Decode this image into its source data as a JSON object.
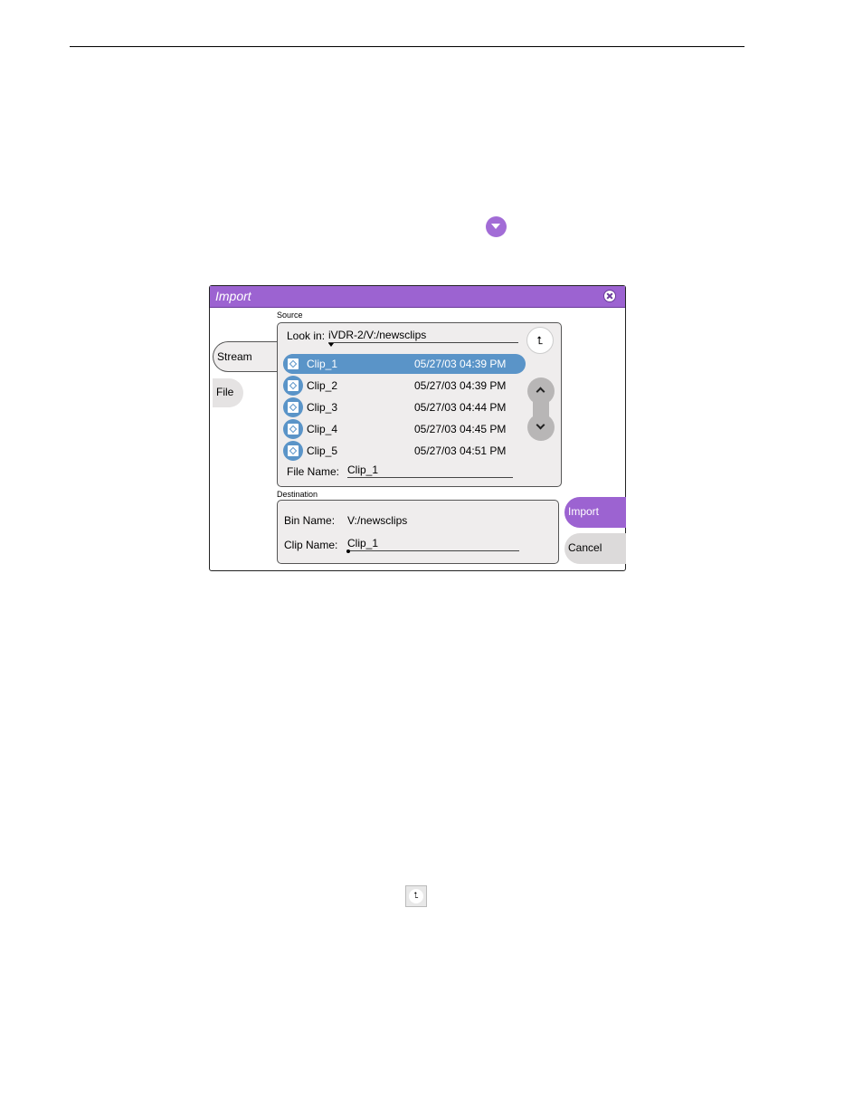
{
  "dialog": {
    "title": "Import",
    "source_label": "Source",
    "destination_label": "Destination",
    "tabs": [
      {
        "label": "Stream",
        "selected": true
      },
      {
        "label": "File",
        "selected": false
      }
    ],
    "look_in_label": "Look in:",
    "look_in_value": "iVDR-2/V:/newsclips",
    "up_folder_glyph": "⮤",
    "clips": [
      {
        "name": "Clip_1",
        "date": "05/27/03 04:39 PM",
        "selected": true
      },
      {
        "name": "Clip_2",
        "date": "05/27/03 04:39 PM",
        "selected": false
      },
      {
        "name": "Clip_3",
        "date": "05/27/03 04:44 PM",
        "selected": false
      },
      {
        "name": "Clip_4",
        "date": "05/27/03 04:45 PM",
        "selected": false
      },
      {
        "name": "Clip_5",
        "date": "05/27/03 04:51 PM",
        "selected": false
      }
    ],
    "file_name_label": "File Name:",
    "file_name_value": "Clip_1",
    "bin_name_label": "Bin Name:",
    "bin_name_value": "V:/newsclips",
    "clip_name_label": "Clip Name:",
    "clip_name_value": "Clip_1",
    "import_button": "Import",
    "cancel_button": "Cancel"
  },
  "colors": {
    "titlebar": "#9c63d1",
    "selection": "#5a94c8",
    "panel_bg": "#efeded"
  },
  "icons": [
    "dropdown-arrow-icon",
    "close-icon",
    "up-folder-icon",
    "clip-icon",
    "scroll-up-icon",
    "scroll-down-icon"
  ]
}
